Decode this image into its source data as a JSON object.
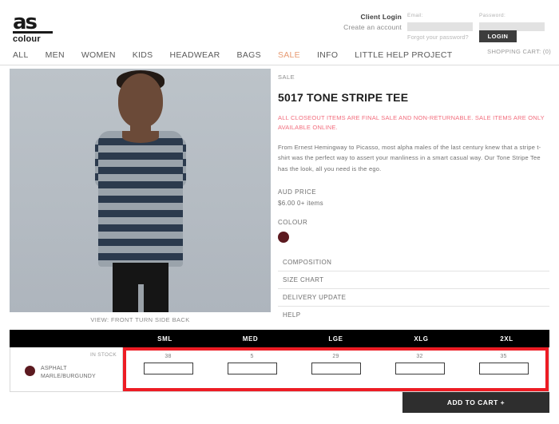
{
  "header": {
    "logo_mark": "as",
    "logo_word": "colour",
    "login": {
      "client_login": "Client Login",
      "create_account": "Create an account",
      "email_label": "Email:",
      "email_value": "",
      "password_label": "Password:",
      "password_value": "",
      "forgot": "Forgot your password?",
      "login_button": "LOGIN"
    },
    "cart": "SHOPPING CART: (0)"
  },
  "nav": {
    "items": [
      {
        "label": "ALL",
        "sale": false
      },
      {
        "label": "MEN",
        "sale": false
      },
      {
        "label": "WOMEN",
        "sale": false
      },
      {
        "label": "KIDS",
        "sale": false
      },
      {
        "label": "HEADWEAR",
        "sale": false
      },
      {
        "label": "BAGS",
        "sale": false
      },
      {
        "label": "SALE",
        "sale": true
      },
      {
        "label": "INFO",
        "sale": false
      },
      {
        "label": "LITTLE HELP PROJECT",
        "sale": false
      }
    ],
    "sale_color": "#e79a72"
  },
  "gallery": {
    "view_label": "VIEW:",
    "views": [
      "FRONT",
      "TURN",
      "SIDE",
      "BACK"
    ],
    "background_color": "#b9c0c6",
    "stripe_dark": "#2b3a4d",
    "stripe_light": "#9aa3ab"
  },
  "product": {
    "category": "SALE",
    "title": "5017 TONE STRIPE TEE",
    "warning": "ALL CLOSEOUT ITEMS ARE FINAL SALE AND NON-RETURNABLE. SALE ITEMS ARE ONLY AVAILABLE ONLINE.",
    "description": "From Ernest Hemingway to Picasso, most alpha males of the last century knew that a stripe t-shirt was the perfect way to assert your manliness in a smart casual way.  Our Tone Stripe Tee has the look, all you need is the ego.",
    "price_label": "AUD PRICE",
    "price_value": "$6.00  0+ items",
    "colour_label": "COLOUR",
    "swatch_color": "#5c1a20",
    "warning_color": "#f26d7d",
    "accordion": [
      "COMPOSITION",
      "SIZE CHART",
      "DELIVERY UPDATE",
      "HELP"
    ]
  },
  "size_table": {
    "sizes": [
      "SML",
      "MED",
      "LGE",
      "XLG",
      "2XL"
    ],
    "in_stock_label": "IN STOCK",
    "colour_name_line1": "ASPHALT",
    "colour_name_line2": "MARLE/BURGUNDY",
    "colour_dot": "#5c1a20",
    "stock": [
      "38",
      "5",
      "29",
      "32",
      "35"
    ],
    "qty_values": [
      "",
      "",
      "",
      "",
      ""
    ],
    "highlight_color": "#ed1c24"
  },
  "footer": {
    "add_to_cart": "ADD TO CART +"
  }
}
